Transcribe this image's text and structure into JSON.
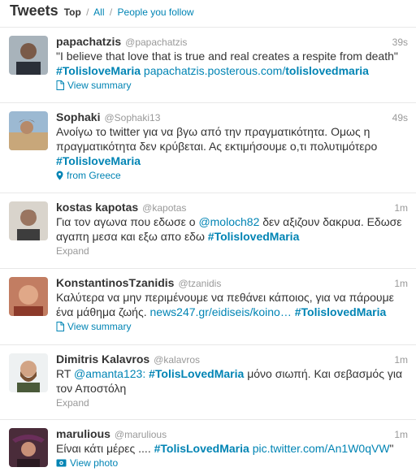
{
  "header": {
    "title": "Tweets",
    "filter_top": "Top",
    "filter_all": "All",
    "filter_following": "People you follow",
    "separator": "/"
  },
  "tweets": [
    {
      "fullname": "papachatzis",
      "username": "@papachatzis",
      "time": "39s",
      "quote": "\"I believe that love that is true and real creates a respite from death\"",
      "hashtag": "#TolisloveMaria",
      "link_pre": "papachatzis.posterous.com/",
      "link_bold": "tolislovedmaria",
      "action": "View summary",
      "action_icon": "document-icon"
    },
    {
      "fullname": "Sophaki",
      "username": "@Sophaki13",
      "time": "49s",
      "text": "Ανοίγω το twitter για να βγω από την πραγματικότητα. Ομως η πραγματικότητα δεν κρύβεται. Ας εκτιμήσουμε ο,τι πολυτιμότερο",
      "hashtag": "#TolisloveMaria",
      "action": "from Greece",
      "action_icon": "location-pin-icon"
    },
    {
      "fullname": "kostas kapotas",
      "username": "@kapotas",
      "time": "1m",
      "text_pre": "Για τον αγωνα που εδωσε ο ",
      "mention": "@moloch82",
      "text_mid": " δεν αξιζουν δακρυα. Εδωσε αγαπη μεσα και εξω απο εδω ",
      "hashtag": "#TolislovedMaria",
      "action": "Expand"
    },
    {
      "fullname": "KonstantinosTzanidis",
      "username": "@tzanidis",
      "time": "1m",
      "text_pre": "Καλύτερα να μην περιμένουμε να πεθάνει κάποιος, για να πάρουμε ένα μάθημα ζωής. ",
      "link": "news247.gr/eidiseis/koino…",
      "hashtag": "#TolislovedMaria",
      "action": "View summary",
      "action_icon": "document-icon"
    },
    {
      "fullname": "Dimitris Kalavros",
      "username": "@kalavros",
      "time": "1m",
      "text_pre": "RT ",
      "mention": "@amanta123:",
      "hashtag": "#TolisLovedMaria",
      "text_post": " μόνο σιωπή. Και σεβασμός για τον Αποστόλη",
      "action": "Expand"
    },
    {
      "fullname": "marulious",
      "username": "@marulious",
      "time": "1m",
      "text_pre": "Είναι κάτι μέρες .... ",
      "hashtag": "#TolisLovedMaria",
      "link": "pic.twitter.com/An1W0qVW",
      "text_post": "\"",
      "action": "View photo",
      "action_icon": "photo-icon"
    }
  ],
  "colors": {
    "link": "#0084b4",
    "text": "#333333",
    "meta": "#999999",
    "divider": "#e8e8e8"
  }
}
